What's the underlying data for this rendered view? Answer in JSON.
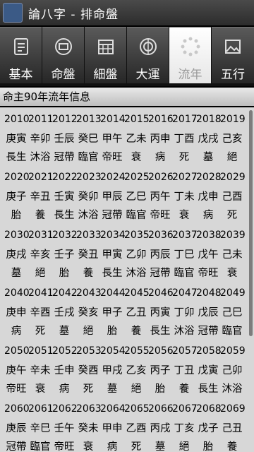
{
  "window": {
    "title": "論八字 - 排命盤"
  },
  "tabs": [
    {
      "label": "基本",
      "icon": "person-list-icon",
      "active": false
    },
    {
      "label": "命盤",
      "icon": "chart-wheel-icon",
      "active": false
    },
    {
      "label": "細盤",
      "icon": "calendar-grid-icon",
      "active": false
    },
    {
      "label": "大運",
      "icon": "compass-icon",
      "active": false
    },
    {
      "label": "流年",
      "icon": "spinner-icon",
      "active": true
    },
    {
      "label": "五行",
      "icon": "landscape-icon",
      "active": false
    }
  ],
  "header": {
    "text": "命主90年流年信息"
  },
  "blocks": [
    {
      "years": [
        "2010",
        "2011",
        "2012",
        "2013",
        "2014",
        "2015",
        "2016",
        "2017",
        "2018",
        "2019"
      ],
      "ganzhi": [
        "庚寅",
        "辛卯",
        "壬辰",
        "癸巳",
        "甲午",
        "乙未",
        "丙申",
        "丁酉",
        "戊戌",
        "己亥"
      ],
      "stage": [
        "長生",
        "沐浴",
        "冠帶",
        "臨官",
        "帝旺",
        "衰",
        "病",
        "死",
        "墓",
        "絕"
      ]
    },
    {
      "years": [
        "2020",
        "2021",
        "2022",
        "2023",
        "2024",
        "2025",
        "2026",
        "2027",
        "2028",
        "2029"
      ],
      "ganzhi": [
        "庚子",
        "辛丑",
        "壬寅",
        "癸卯",
        "甲辰",
        "乙巳",
        "丙午",
        "丁未",
        "戊申",
        "己酉"
      ],
      "stage": [
        "胎",
        "養",
        "長生",
        "沐浴",
        "冠帶",
        "臨官",
        "帝旺",
        "衰",
        "病",
        "死"
      ]
    },
    {
      "years": [
        "2030",
        "2031",
        "2032",
        "2033",
        "2034",
        "2035",
        "2036",
        "2037",
        "2038",
        "2039"
      ],
      "ganzhi": [
        "庚戌",
        "辛亥",
        "壬子",
        "癸丑",
        "甲寅",
        "乙卯",
        "丙辰",
        "丁巳",
        "戊午",
        "己未"
      ],
      "stage": [
        "墓",
        "絕",
        "胎",
        "養",
        "長生",
        "沐浴",
        "冠帶",
        "臨官",
        "帝旺",
        "衰"
      ]
    },
    {
      "years": [
        "2040",
        "2041",
        "2042",
        "2043",
        "2044",
        "2045",
        "2046",
        "2047",
        "2048",
        "2049"
      ],
      "ganzhi": [
        "庚申",
        "辛酉",
        "壬戌",
        "癸亥",
        "甲子",
        "乙丑",
        "丙寅",
        "丁卯",
        "戊辰",
        "己巳"
      ],
      "stage": [
        "病",
        "死",
        "墓",
        "絕",
        "胎",
        "養",
        "長生",
        "沐浴",
        "冠帶",
        "臨官"
      ]
    },
    {
      "years": [
        "2050",
        "2051",
        "2052",
        "2053",
        "2054",
        "2055",
        "2056",
        "2057",
        "2058",
        "2059"
      ],
      "ganzhi": [
        "庚午",
        "辛未",
        "壬申",
        "癸酉",
        "甲戌",
        "乙亥",
        "丙子",
        "丁丑",
        "戊寅",
        "己卯"
      ],
      "stage": [
        "帝旺",
        "衰",
        "病",
        "死",
        "墓",
        "絕",
        "胎",
        "養",
        "長生",
        "沐浴"
      ]
    },
    {
      "years": [
        "2060",
        "2061",
        "2062",
        "2063",
        "2064",
        "2065",
        "2066",
        "2067",
        "2068",
        "2069"
      ],
      "ganzhi": [
        "庚辰",
        "辛巳",
        "壬午",
        "癸未",
        "甲申",
        "乙酉",
        "丙戌",
        "丁亥",
        "戊子",
        "己丑"
      ],
      "stage": [
        "冠帶",
        "臨官",
        "帝旺",
        "衰",
        "病",
        "死",
        "墓",
        "絕",
        "胎",
        "養"
      ]
    }
  ]
}
